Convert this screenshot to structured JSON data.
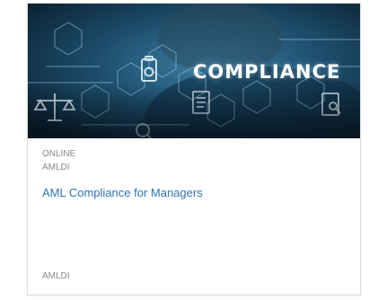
{
  "card": {
    "banner_text": "COMPLIANCE",
    "format": "ONLINE",
    "provider": "AMLDI",
    "title": "AML Compliance for Managers",
    "footer_provider": "AMLDI"
  },
  "colors": {
    "banner_background": "#123a52",
    "title_link": "#2f72b5",
    "meta_text": "#888888"
  }
}
